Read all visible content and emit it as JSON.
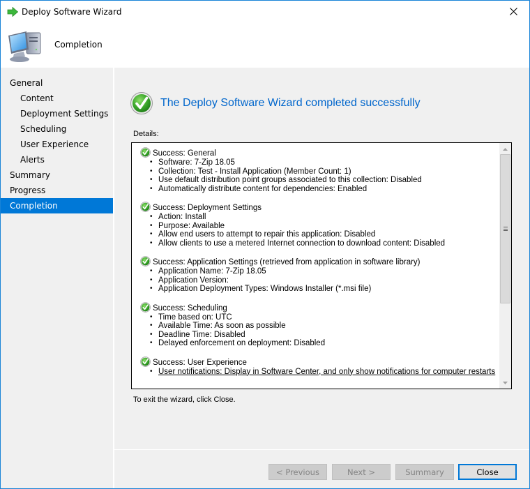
{
  "window": {
    "title": "Deploy Software Wizard",
    "app_icon": "green-arrow-icon",
    "close_icon": "close-icon"
  },
  "header": {
    "title": "Completion",
    "icon": "computer-icon"
  },
  "sidebar": {
    "items": [
      {
        "label": "General",
        "level": 0,
        "active": false
      },
      {
        "label": "Content",
        "level": 1,
        "active": false
      },
      {
        "label": "Deployment Settings",
        "level": 1,
        "active": false
      },
      {
        "label": "Scheduling",
        "level": 1,
        "active": false
      },
      {
        "label": "User Experience",
        "level": 1,
        "active": false
      },
      {
        "label": "Alerts",
        "level": 1,
        "active": false
      },
      {
        "label": "Summary",
        "level": 0,
        "active": false
      },
      {
        "label": "Progress",
        "level": 0,
        "active": false
      },
      {
        "label": "Completion",
        "level": 0,
        "active": true
      }
    ]
  },
  "main": {
    "success_title": "The Deploy Software Wizard completed successfully",
    "details_label": "Details:",
    "exit_text": "To exit the wizard, click Close.",
    "sections": [
      {
        "title": "Success: General",
        "items": [
          "Software: 7-Zip 18.05",
          "Collection: Test - Install Application (Member Count: 1)",
          "Use default distribution point groups associated to this collection: Disabled",
          "Automatically distribute content for dependencies: Enabled"
        ]
      },
      {
        "title": "Success: Deployment Settings",
        "items": [
          "Action: Install",
          "Purpose: Available",
          "Allow end users to attempt to repair this application: Disabled",
          "Allow clients to use a metered Internet connection to download content: Disabled"
        ]
      },
      {
        "title": "Success: Application Settings (retrieved from application in software library)",
        "items": [
          "Application Name: 7-Zip 18.05",
          "Application Version:",
          "Application Deployment Types: Windows Installer (*.msi file)"
        ]
      },
      {
        "title": "Success: Scheduling",
        "items": [
          "Time based on: UTC",
          "Available Time: As soon as possible",
          "Deadline Time: Disabled",
          "Delayed enforcement on deployment: Disabled"
        ]
      },
      {
        "title": "Success: User Experience",
        "items": [
          "User notifications: Display in Software Center, and only show notifications for computer restarts"
        ]
      }
    ]
  },
  "buttons": {
    "previous": "< Previous",
    "next": "Next >",
    "summary": "Summary",
    "close": "Close"
  },
  "colors": {
    "accent": "#0078d7",
    "title_blue": "#0066cc",
    "success_green": "#3aa52a"
  }
}
